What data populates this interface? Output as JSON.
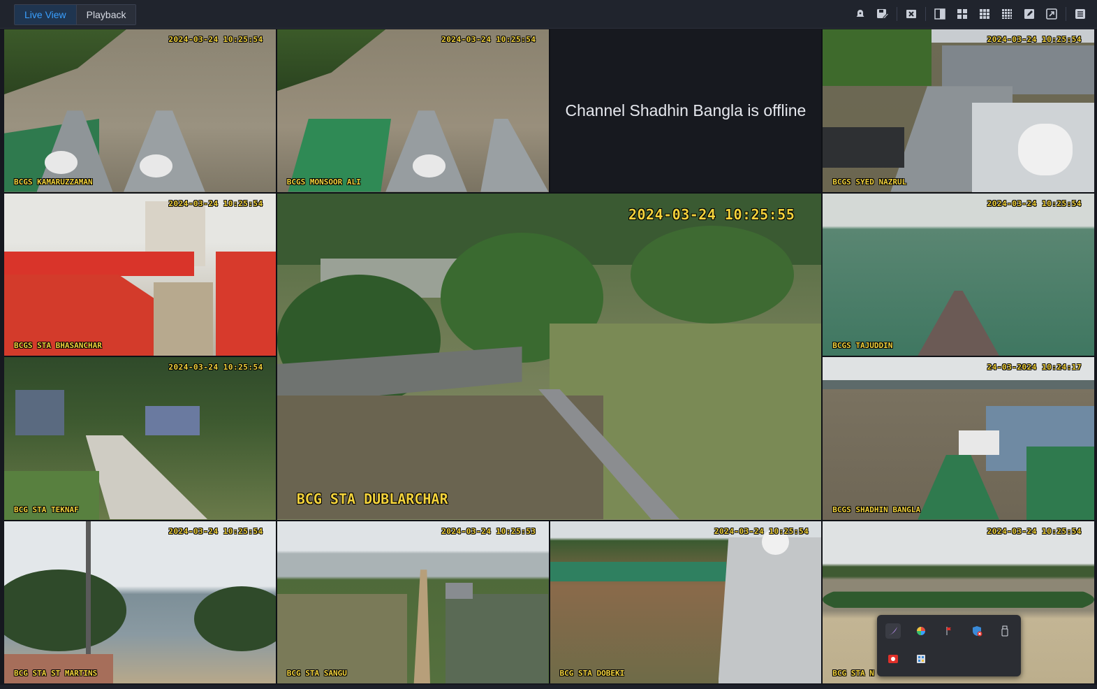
{
  "toolbar": {
    "tabs": [
      {
        "label": "Live View",
        "active": true
      },
      {
        "label": "Playback",
        "active": false
      }
    ],
    "icons": [
      "alarm-icon",
      "save-layout-icon",
      "close-all-icon",
      "split-view-icon",
      "grid-2x2-icon",
      "grid-3x3-icon",
      "grid-4x4-icon",
      "edit-layout-icon",
      "fullscreen-icon",
      "menu-icon"
    ]
  },
  "tiles": [
    {
      "name": "BCGS KAMARUZZAMAN",
      "timestamp": "2024-03-24 10:25:54"
    },
    {
      "name": "BCGS MONSOOR ALI",
      "timestamp": "2024-03-24 10:25:54"
    },
    {
      "offline_message": "Channel Shadhin Bangla is offline"
    },
    {
      "name": "BCGS SYED NAZRUL",
      "timestamp": "2024-03-24 10:25:54"
    },
    {
      "name": "BCGS STA BHASANCHAR",
      "timestamp": "2024-03-24 10:25:54"
    },
    {
      "name": "BCG STA DUBLARCHAR",
      "timestamp": "2024-03-24 10:25:55"
    },
    {
      "name": "BCGS TAJUDDIN",
      "timestamp": "2024-03-24 10:25:54"
    },
    {
      "name": "BCG STA TEKNAF",
      "timestamp": "2024-03-24 10:25:54",
      "selected": true
    },
    {
      "name": "BCGS SHADHIN BANGLA",
      "timestamp": "24-03-2024 10:24:17"
    },
    {
      "name": "BCG STA ST MARTINS",
      "timestamp": "2024-03-24 10:25:54"
    },
    {
      "name": "BCG STA SANGU",
      "timestamp": "2024-03-24 10:25:53"
    },
    {
      "name": "BCG STA DOBEKI",
      "timestamp": "2024-03-24 10:25:54"
    },
    {
      "name": "BCG STA N",
      "timestamp": "2024-03-24 10:25:54"
    }
  ],
  "tray": {
    "icons": [
      "pen-icon",
      "color-wheel-icon",
      "flag-icon",
      "security-shield-icon",
      "usb-drive-icon",
      "record-icon",
      "network-share-icon"
    ]
  },
  "colors": {
    "accent": "#3aa0ff",
    "overlay_text": "#f2d23c",
    "background": "#16181f"
  }
}
